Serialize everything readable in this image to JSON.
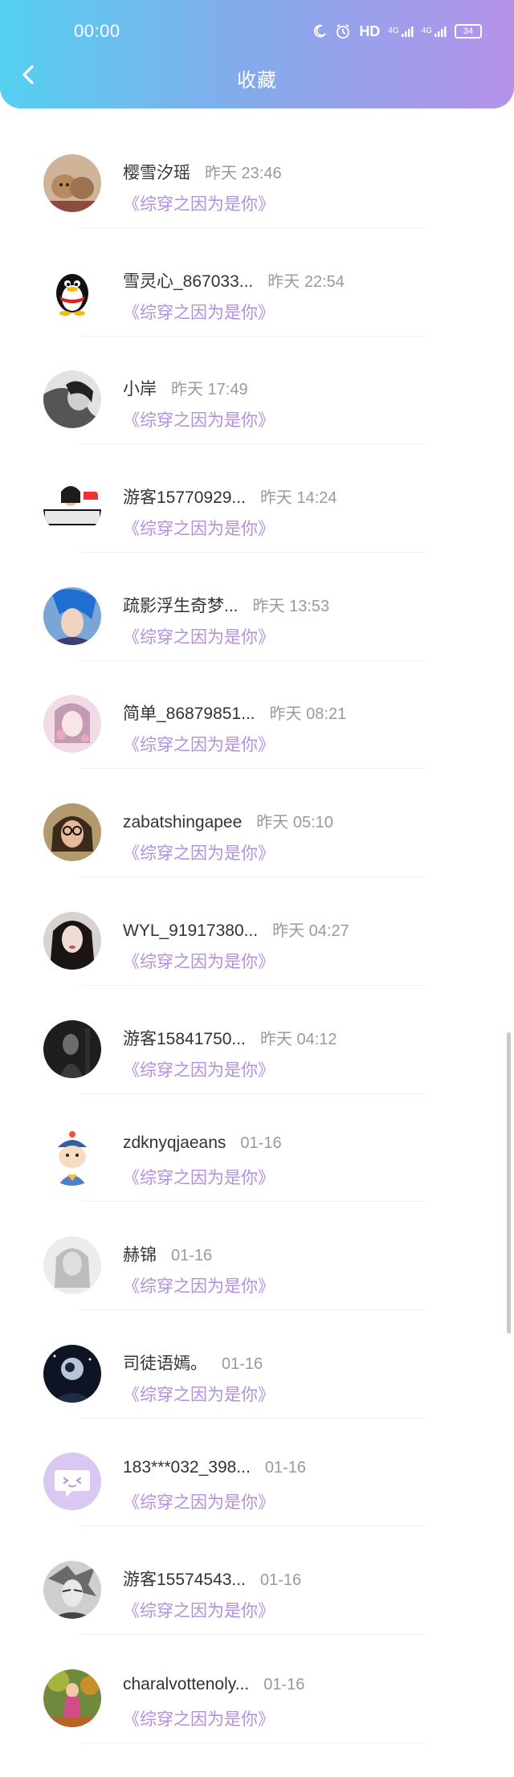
{
  "status_bar": {
    "time": "00:00",
    "hd_label": "HD",
    "signal1_label": "4G",
    "signal2_label": "4G",
    "battery": "34"
  },
  "header": {
    "title": "收藏"
  },
  "colors": {
    "header_gradient": [
      "#55d0f0",
      "#b593ea"
    ],
    "book_title": "#b48ee0",
    "timestamp": "#9a9a9a"
  },
  "favorites": [
    {
      "name": "樱雪汐瑶",
      "time": "昨天 23:46",
      "book": "《综穿之因为是你》",
      "avatar": "cats-photo"
    },
    {
      "name": "雪灵心_867033...",
      "time": "昨天 22:54",
      "book": "《综穿之因为是你》",
      "avatar": "penguin-icon"
    },
    {
      "name": "小岸",
      "time": "昨天 17:49",
      "book": "《综穿之因为是你》",
      "avatar": "bw-portrait"
    },
    {
      "name": "游客15770929...",
      "time": "昨天 14:24",
      "book": "《综穿之因为是你》",
      "avatar": "banner-photo"
    },
    {
      "name": "疏影浮生奇梦...",
      "time": "昨天 13:53",
      "book": "《综穿之因为是你》",
      "avatar": "anime-blue-hair"
    },
    {
      "name": "简单_86879851...",
      "time": "昨天 08:21",
      "book": "《综穿之因为是你》",
      "avatar": "pink-portrait"
    },
    {
      "name": "zabatshingapee",
      "time": "昨天 05:10",
      "book": "《综穿之因为是你》",
      "avatar": "glasses-portrait"
    },
    {
      "name": "WYL_91917380...",
      "time": "昨天 04:27",
      "book": "《综穿之因为是你》",
      "avatar": "woman-portrait"
    },
    {
      "name": "游客15841750...",
      "time": "昨天 04:12",
      "book": "《综穿之因为是你》",
      "avatar": "dark-figure"
    },
    {
      "name": "zdknyqjaeans",
      "time": "01-16",
      "book": "《综穿之因为是你》",
      "avatar": "cartoon-emperor"
    },
    {
      "name": "赫锦",
      "time": "01-16",
      "book": "《综穿之因为是你》",
      "avatar": "faded-portrait"
    },
    {
      "name": "司徒语嫣。",
      "time": "01-16",
      "book": "《综穿之因为是你》",
      "avatar": "night-moon"
    },
    {
      "name": "183***032_398...",
      "time": "01-16",
      "book": "《综穿之因为是你》",
      "avatar": "chat-bubble-icon"
    },
    {
      "name": "游客15574543...",
      "time": "01-16",
      "book": "《综穿之因为是你》",
      "avatar": "sketch-portrait"
    },
    {
      "name": "charalvottenoly...",
      "time": "01-16",
      "book": "《综穿之因为是你》",
      "avatar": "autumn-photo"
    }
  ]
}
